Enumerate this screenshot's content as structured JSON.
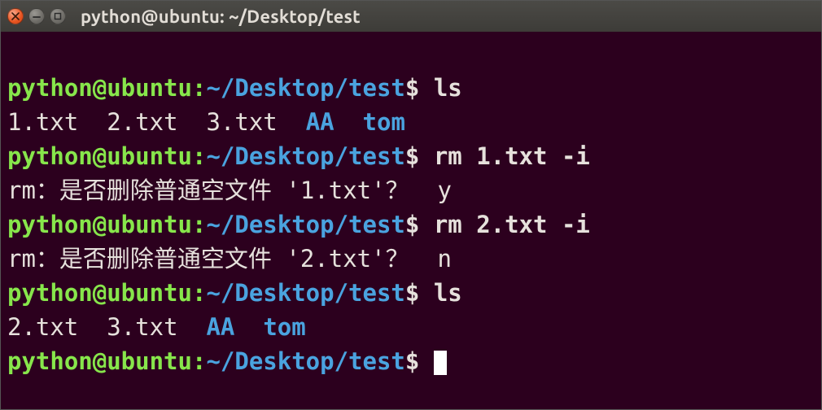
{
  "window": {
    "title": "python@ubuntu: ~/Desktop/test"
  },
  "prompt": {
    "user": "python@ubuntu",
    "sep": ":",
    "path": "~/Desktop/test",
    "symbol": "$"
  },
  "lines": {
    "cmd1": "ls",
    "ls1": {
      "f1": "1.txt",
      "f2": "2.txt",
      "f3": "3.txt",
      "d1": "AA",
      "d2": "tom"
    },
    "cmd2": "rm 1.txt -i",
    "rm1": {
      "prefix": "rm：是否删除普通空文件 '1.txt'？ ",
      "answer": "y"
    },
    "cmd3": "rm 2.txt -i",
    "rm2": {
      "prefix": "rm：是否删除普通空文件 '2.txt'？ ",
      "answer": "n"
    },
    "cmd4": "ls",
    "ls2": {
      "f1": "2.txt",
      "f2": "3.txt",
      "d1": "AA",
      "d2": "tom"
    }
  }
}
